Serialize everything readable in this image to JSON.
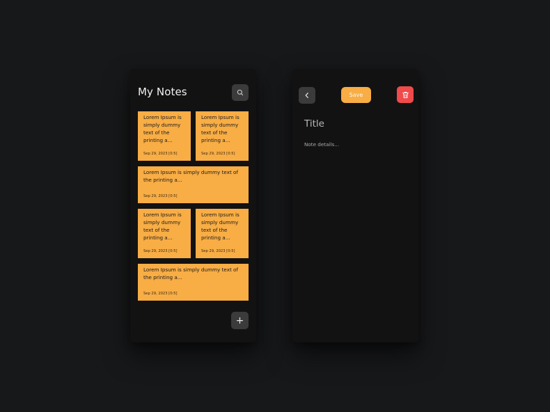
{
  "list_screen": {
    "title": "My Notes",
    "search_icon": "search-icon",
    "add_icon": "plus-icon",
    "add_label": "+",
    "notes": [
      {
        "text": "Lorem Ipsum is simply dummy text of the printing a...",
        "date": "Sep 29, 2023 [0:5]"
      },
      {
        "text": "Lorem Ipsum is simply dummy text of the printing a...",
        "date": "Sep 29, 2023 [0:5]"
      },
      {
        "text": "Lorem Ipsum is simply dummy text of the printing a...",
        "date": "Sep 29, 2023 [0:5]"
      },
      {
        "text": "Lorem Ipsum is simply dummy text of the printing a...",
        "date": "Sep 29, 2023 [0:5]"
      },
      {
        "text": "Lorem Ipsum is simply dummy text of the printing a...",
        "date": "Sep 29, 2023 [0:5]"
      },
      {
        "text": "Lorem Ipsum is simply dummy text of the printing a...",
        "date": "Sep 29, 2023 [0:5]"
      }
    ]
  },
  "edit_screen": {
    "back_icon": "chevron-left-icon",
    "save_label": "Save",
    "delete_icon": "trash-icon",
    "title_placeholder": "Title",
    "details_placeholder": "Note details..."
  },
  "colors": {
    "background": "#17181a",
    "card": "#121213",
    "note": "#f8ad45",
    "accent_delete": "#f04a4a",
    "button_gray": "#3b3b3c"
  }
}
